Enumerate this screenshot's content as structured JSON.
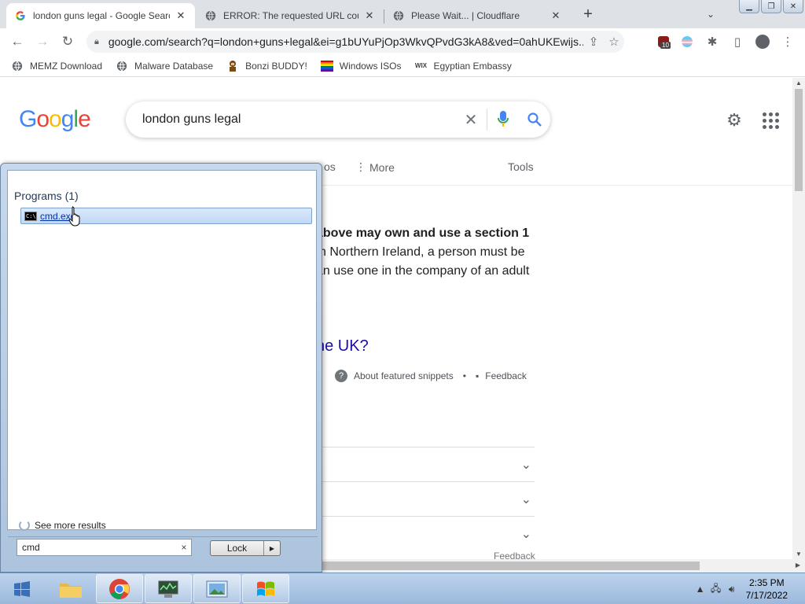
{
  "tabs": [
    {
      "title": "london guns legal - Google Search",
      "favicon": "google-g-icon",
      "active": true
    },
    {
      "title": "ERROR: The requested URL could not be retrieved",
      "favicon": "globe-icon",
      "active": false
    },
    {
      "title": "Please Wait... | Cloudflare",
      "favicon": "globe-icon",
      "active": false
    }
  ],
  "toolbar": {
    "url": "google.com/search?q=london+guns+legal&ei=g1bUYuPjOp3WkvQPvdG3kA8&ved=0ahUKEwijs...",
    "extension_badge": "10"
  },
  "bookmarks": [
    {
      "label": "MEMZ Download",
      "icon": "globe-icon"
    },
    {
      "label": "Malware Database",
      "icon": "globe-icon"
    },
    {
      "label": "Bonzi BUDDY!",
      "icon": "bonzi-icon"
    },
    {
      "label": "Windows ISOs",
      "icon": "windows-flag-icon"
    },
    {
      "label": "Egyptian Embassy",
      "icon": "wix-icon"
    }
  ],
  "google": {
    "query": "london guns legal",
    "tabs_visible": [
      "os",
      "More",
      "Tools"
    ],
    "snippet_lines": [
      "above may own and use a section 1",
      "n Northern Ireland, a person must be",
      "an use one in the company of an adult"
    ],
    "question_link": "he UK?",
    "about": "About featured snippets",
    "feedback": "Feedback",
    "feedback_bottom": "Feedback"
  },
  "start_menu": {
    "group_label": "Programs (1)",
    "program": "cmd.exe",
    "see_more": "See more results",
    "search_value": "cmd",
    "lock_label": "Lock"
  },
  "taskbar": {
    "time": "2:35 PM",
    "date": "7/17/2022"
  },
  "colors": {
    "accent_blue": "#1a73e8",
    "link": "#1a0dab",
    "taskbar": "#bcd3ed"
  }
}
